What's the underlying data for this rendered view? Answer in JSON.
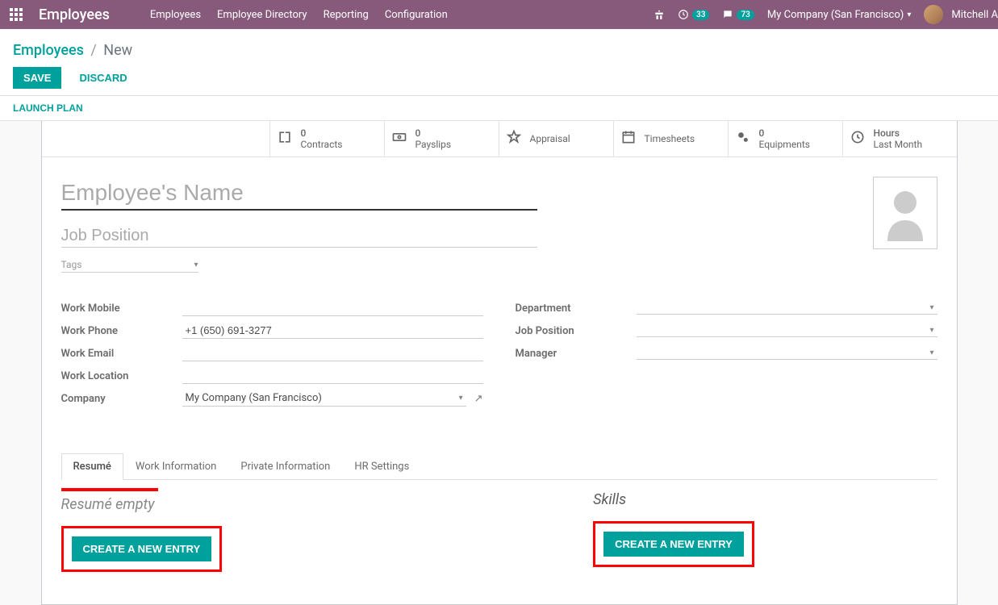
{
  "header": {
    "app_title": "Employees",
    "menus": [
      "Employees",
      "Employee Directory",
      "Reporting",
      "Configuration"
    ],
    "activity_count": "33",
    "message_count": "73",
    "company": "My Company (San Francisco)",
    "user_name": "Mitchell A"
  },
  "breadcrumb": {
    "root": "Employees",
    "current": "New"
  },
  "actions": {
    "save": "SAVE",
    "discard": "DISCARD",
    "launch_plan": "LAUNCH PLAN"
  },
  "stat_buttons": [
    {
      "count": "0",
      "label": "Contracts"
    },
    {
      "count": "0",
      "label": "Payslips"
    },
    {
      "count": "",
      "label": "Appraisal"
    },
    {
      "count": "",
      "label": "Timesheets"
    },
    {
      "count": "0",
      "label": "Equipments"
    },
    {
      "count": "Hours",
      "label": "Last Month"
    }
  ],
  "form": {
    "name_placeholder": "Employee's Name",
    "job_position_placeholder": "Job Position",
    "tags_placeholder": "Tags",
    "left_fields": {
      "work_mobile_label": "Work Mobile",
      "work_mobile_value": "",
      "work_phone_label": "Work Phone",
      "work_phone_value": "+1 (650) 691-3277",
      "work_email_label": "Work Email",
      "work_email_value": "",
      "work_location_label": "Work Location",
      "work_location_value": "",
      "company_label": "Company",
      "company_value": "My Company (San Francisco)"
    },
    "right_fields": {
      "department_label": "Department",
      "department_value": "",
      "job_position_label": "Job Position",
      "job_position_value": "",
      "manager_label": "Manager",
      "manager_value": ""
    }
  },
  "tabs": [
    "Resumé",
    "Work Information",
    "Private Information",
    "HR Settings"
  ],
  "resume_section": {
    "heading": "Resumé empty",
    "button": "CREATE A NEW ENTRY"
  },
  "skills_section": {
    "heading": "Skills",
    "button": "CREATE A NEW ENTRY"
  }
}
